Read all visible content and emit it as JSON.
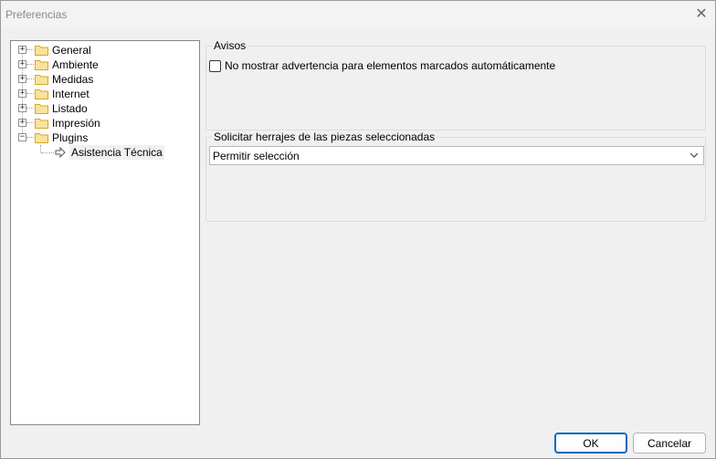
{
  "window": {
    "title": "Preferencias"
  },
  "tree": {
    "items": [
      {
        "label": "General",
        "expander": "+"
      },
      {
        "label": "Ambiente",
        "expander": "+"
      },
      {
        "label": "Medidas",
        "expander": "+"
      },
      {
        "label": "Internet",
        "expander": "+"
      },
      {
        "label": "Listado",
        "expander": "+"
      },
      {
        "label": "Impresión",
        "expander": "+"
      },
      {
        "label": "Plugins",
        "expander": "−"
      }
    ],
    "children": [
      {
        "label": "Asistencia Técnica",
        "selected": true
      }
    ]
  },
  "avisos": {
    "title": "Avisos",
    "checkbox_label": "No mostrar advertencia para elementos marcados automáticamente",
    "checked": false
  },
  "herrajes": {
    "title": "Solicitar herrajes de las piezas seleccionadas",
    "selected_option": "Permitir selección"
  },
  "buttons": {
    "ok": "OK",
    "cancel": "Cancelar"
  },
  "colors": {
    "folder_fill": "#fbe29a",
    "folder_stroke": "#d6a829",
    "accent": "#0067c0"
  }
}
